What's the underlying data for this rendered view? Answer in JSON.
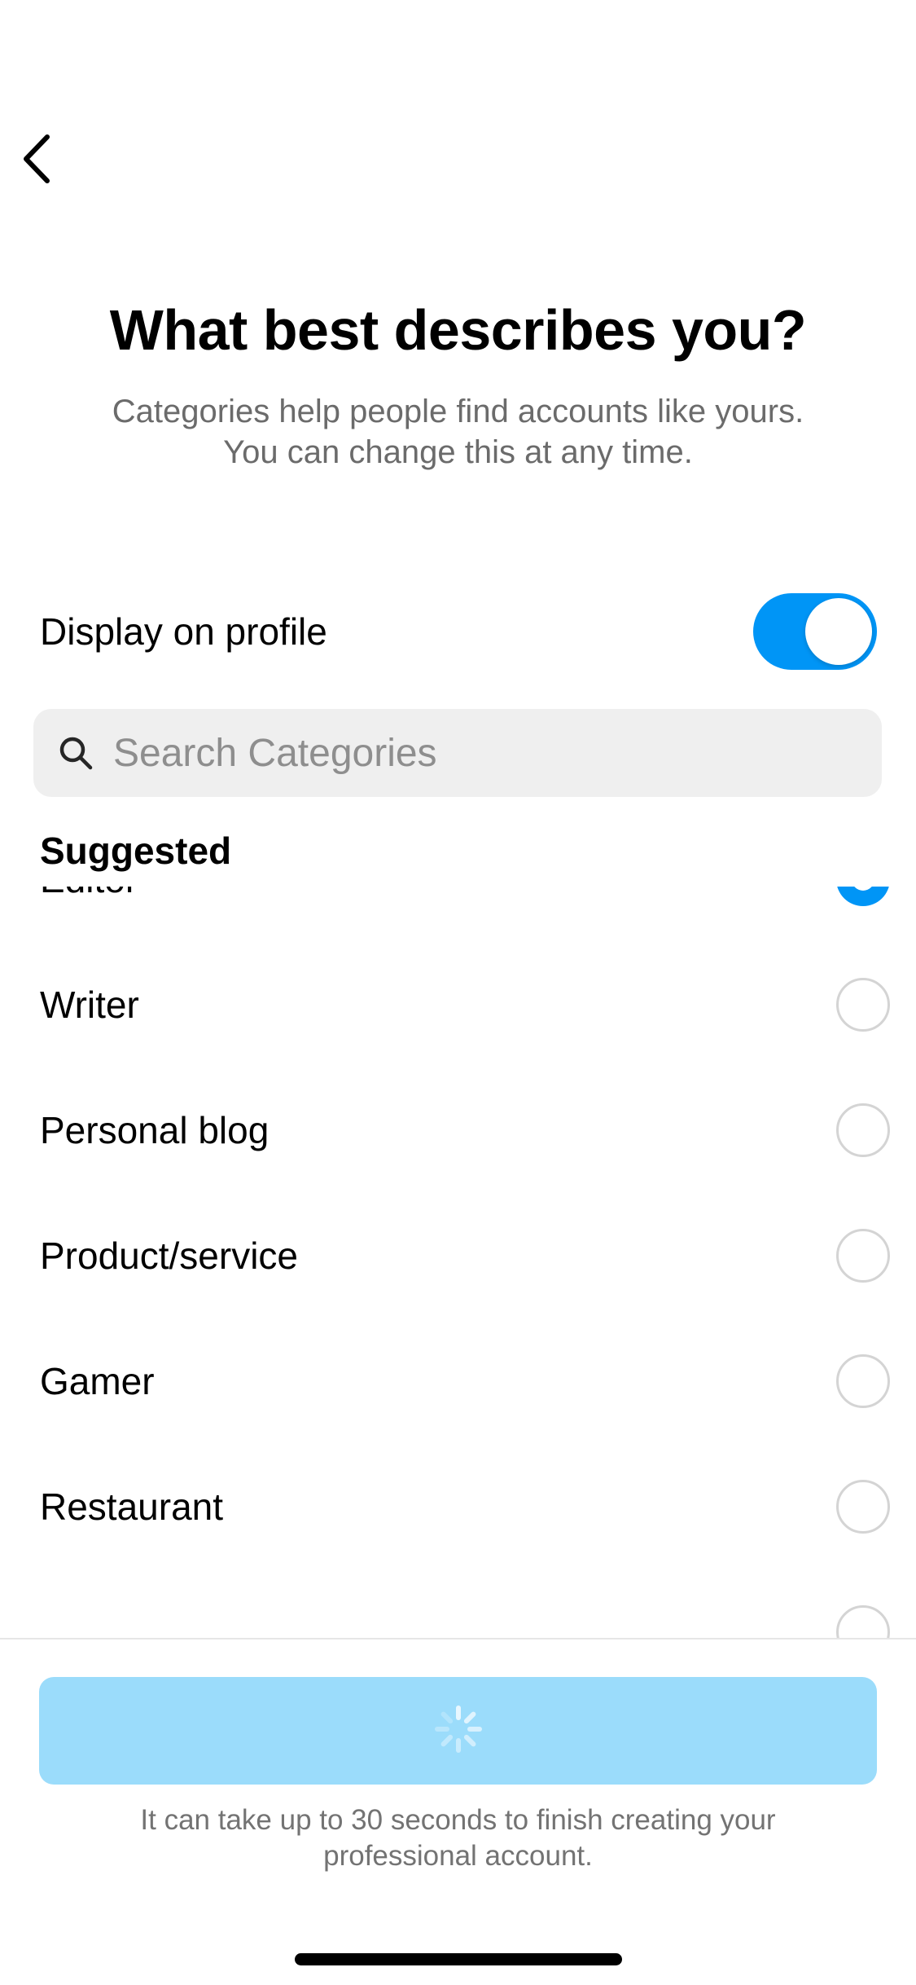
{
  "header": {
    "back_icon": "chevron-left-icon",
    "title": "What best describes you?",
    "subtitle_line1": "Categories help people find accounts like yours.",
    "subtitle_line2": "You can change this at any time."
  },
  "display_toggle": {
    "label": "Display on profile",
    "on": true,
    "accent_color": "#0095f6"
  },
  "search": {
    "icon": "search-icon",
    "placeholder": "Search Categories",
    "value": ""
  },
  "section": {
    "title": "Suggested"
  },
  "categories": [
    {
      "label": "Editor",
      "selected": true
    },
    {
      "label": "Writer",
      "selected": false
    },
    {
      "label": "Personal blog",
      "selected": false
    },
    {
      "label": "Product/service",
      "selected": false
    },
    {
      "label": "Gamer",
      "selected": false
    },
    {
      "label": "Restaurant",
      "selected": false
    },
    {
      "label": "",
      "selected": false
    }
  ],
  "footer": {
    "button_state": "loading",
    "button_color": "#9bdcfb",
    "spinner_icon": "loading-spinner-icon",
    "note": "It can take up to 30 seconds to finish creating your professional account."
  }
}
